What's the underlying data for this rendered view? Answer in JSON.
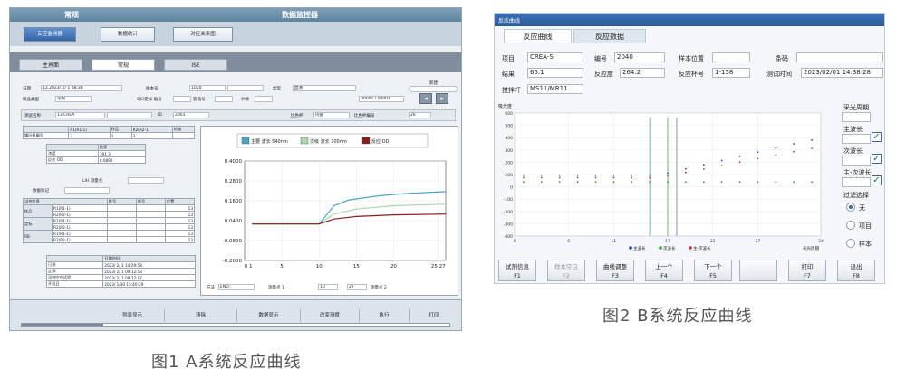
{
  "panel_a": {
    "title_left": "常规",
    "title_right": "数据监控器",
    "top_buttons": [
      "反应监测器",
      "数据统计",
      "对应关系图"
    ],
    "tabs": [
      "主界面",
      "常规",
      "ISE"
    ],
    "rows": {
      "date_label": "日期",
      "date_value": "12.2023/ 2/ 1 08:38",
      "sample_no_label": "样本号",
      "sample_no_value": "1020",
      "type_label": "类型",
      "type_value": "血清",
      "new_label": "新建",
      "sample_type_label": "样品类型",
      "sample_type_value": "常规",
      "qc_label": "QC/定标 编号",
      "container_label": "容器号",
      "count_label": "计数",
      "page_value": "00001 / 00001",
      "test_label": "测试名称",
      "test_value": "13.CREA",
      "id_label": "ID",
      "id_value": "2001",
      "ratio_label": "比色杯",
      "ratio_value": "内部",
      "cuvette_label": "比色杯编号",
      "cuvette_value": "26"
    },
    "reagent_table": {
      "headers": [
        "",
        "R1(R1-1)",
        "样品",
        "R2(R2-1)",
        "检查"
      ],
      "row": [
        "履历瓶编号",
        "3",
        "1",
        "3",
        ""
      ]
    },
    "result_table": {
      "header": "结果",
      "rows": [
        [
          "浓度",
          "391.3"
        ],
        [
          "反应 OD",
          "0.0892"
        ]
      ]
    },
    "lih_label": "LIH 测量点",
    "data_mark_label": "数据标记",
    "reagent2": {
      "headers": [
        "试剂信息",
        "批号",
        "瓶号",
        "位置"
      ],
      "groups": [
        {
          "name": "样品",
          "rows": [
            [
              "R1(R1-1)",
              "13"
            ],
            [
              "R2(R2-1)",
              "13"
            ]
          ]
        },
        {
          "name": "定标",
          "rows": [
            [
              "R1(R1-1)",
              "13"
            ],
            [
              "R2(R2-1)",
              "13"
            ]
          ]
        },
        {
          "name": "RB",
          "rows": [
            [
              "R1(R1-1)",
              "13"
            ],
            [
              "R2(R2-1)",
              "13"
            ]
          ]
        }
      ]
    },
    "datetime_table": {
      "header": "日期/时间",
      "rows": [
        [
          "已测",
          "2023/ 2/ 1 14:29:58"
        ],
        [
          "定标",
          "2023/ 2/ 1 09:12:53"
        ],
        [
          "试剂空白试验",
          "2023/ 2/ 1 09:12:17"
        ],
        [
          "开瓶日",
          "2023/ 1/30 15:40:29"
        ]
      ]
    },
    "chart_legend": [
      "主要 波长 540nm",
      "次级 波长 700nm",
      "反应 OD"
    ],
    "chart_colors": [
      "#4aa3c8",
      "#a8d8a8",
      "#8b1a1a"
    ],
    "yticks": [
      "0.4000",
      "0.2800",
      "0.1600",
      "0.0400",
      "-0.0800",
      "-0.2000"
    ],
    "xticks": [
      "0 1",
      "5",
      "10",
      "15",
      "20",
      "25 27"
    ],
    "method_label": "方法",
    "method_value": "END",
    "mp1_label": "测量点 1",
    "mp1_value": "10",
    "mp2_value": "27",
    "mp2_label": "测量点 2",
    "bottom_buttons": [
      "列表显示",
      "清除",
      "数据显示",
      "改变测度",
      "执行",
      "打印"
    ]
  },
  "panel_b": {
    "title": "反应曲线",
    "tabs": [
      "反应曲线",
      "反应数据"
    ],
    "item_label": "项目",
    "item_value": "CREA-S",
    "code_label": "编号",
    "code_value": "2040",
    "pos_label": "样本位置",
    "pos_value": "",
    "barcode_label": "条码",
    "barcode_value": "",
    "result_label": "结果",
    "result_value": "65.1",
    "react_label": "反应度",
    "react_value": "264.2",
    "cup_label": "反应杯号",
    "cup_value": "1-158",
    "time_label": "测试时间",
    "time_value": "2023/02/01 14:38:28",
    "stir_label": "搅拌杆",
    "stir_value": "MS11/MR11",
    "y_axis_label": "吸光度",
    "yticks": [
      "600",
      "500",
      "400",
      "300",
      "200",
      "100",
      "0",
      "-100",
      "-200",
      "-300",
      "-400"
    ],
    "xticks": [
      "0",
      "6",
      "11",
      "17",
      "22",
      "27",
      "34"
    ],
    "x_axis_label": "采光周期",
    "legend": [
      "主波长",
      "次波长",
      "主-次波长"
    ],
    "legend_colors": [
      "#1f3bbf",
      "#2ca02c",
      "#d62728"
    ],
    "right_fields": [
      "采光周期",
      "主波长",
      "次波长",
      "主-次波长"
    ],
    "filter_label": "过滤选择",
    "radios": [
      "无",
      "项目",
      "样本"
    ],
    "fkeys": [
      [
        "试剂信息",
        "F1"
      ],
      [
        "样本空白",
        "F2"
      ],
      [
        "曲线调整",
        "F3"
      ],
      [
        "上一个",
        "F4"
      ],
      [
        "下一个",
        "F5"
      ],
      [
        "",
        ""
      ],
      [
        "打印",
        "F7"
      ],
      [
        "退出",
        "F8"
      ]
    ]
  },
  "captions": {
    "a": "图1 A系统反应曲线",
    "b": "图2 B系统反应曲线"
  }
}
